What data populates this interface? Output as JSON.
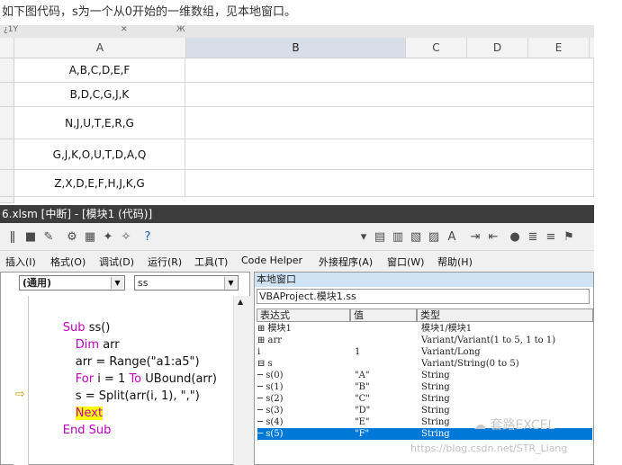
{
  "caption": "如下图代码，s为一个从0开始的一维数组，见本地窗口。",
  "excel": {
    "tab_fragments": [
      "¿1Ÿ",
      "✕",
      "Ж"
    ],
    "columns": [
      "A",
      "B",
      "C",
      "D",
      "E"
    ],
    "cells_A": [
      "A,B,C,D,E,F",
      "B,D,C,G,J,K",
      "N,J,U,T,E,R,G",
      "G,J,K,O,U,T,D,A,Q",
      "Z,X,D,E,F,H,J,K,G"
    ]
  },
  "vbe": {
    "title": "6.xlsm [中断] - [模块1 (代码)]",
    "menu": [
      "插入(I)",
      "格式(O)",
      "调试(D)",
      "运行(R)",
      "工具(T)",
      "Code Helper",
      "外接程序(A)",
      "窗口(W)",
      "帮助(H)"
    ],
    "code_pane": {
      "object_combo": "(通用)",
      "proc_combo": "ss",
      "lines": [
        {
          "parts": [
            {
              "t": "Sub ",
              "kw": true
            },
            {
              "t": "ss()",
              "kw": false
            }
          ]
        },
        {
          "parts": [
            {
              "t": "Dim ",
              "kw": true
            },
            {
              "t": "arr",
              "kw": false
            }
          ]
        },
        {
          "parts": [
            {
              "t": "arr = Range(\"a1:a5\")",
              "kw": false
            }
          ]
        },
        {
          "parts": [
            {
              "t": "For ",
              "kw": true
            },
            {
              "t": "i = 1 ",
              "kw": false
            },
            {
              "t": "To ",
              "kw": true
            },
            {
              "t": "UBound(arr)",
              "kw": false
            }
          ]
        },
        {
          "parts": [
            {
              "t": "s = Split(arr(i, 1), \",\")",
              "kw": false
            }
          ]
        },
        {
          "parts": [
            {
              "t": "Next",
              "kw": true
            }
          ]
        },
        {
          "parts": [
            {
              "t": "End Sub",
              "kw": true
            }
          ]
        }
      ]
    },
    "locals": {
      "title": "本地窗口",
      "context": "VBAProject.模块1.ss",
      "headers": [
        "表达式",
        "值",
        "类型"
      ],
      "rows": [
        {
          "expr": "⊞ 模块1",
          "value": "",
          "type": "模块1/模块1"
        },
        {
          "expr": "⊞ arr",
          "value": "",
          "type": "Variant/Variant(1 to 5, 1 to 1)"
        },
        {
          "expr": "   i",
          "value": "1",
          "type": "Variant/Long"
        },
        {
          "expr": "⊟ s",
          "value": "",
          "type": "Variant/String(0 to 5)"
        },
        {
          "expr": "  ─ s(0)",
          "value": "\"A\"",
          "type": "String"
        },
        {
          "expr": "  ─ s(1)",
          "value": "\"B\"",
          "type": "String"
        },
        {
          "expr": "  ─ s(2)",
          "value": "\"C\"",
          "type": "String"
        },
        {
          "expr": "  ─ s(3)",
          "value": "\"D\"",
          "type": "String"
        },
        {
          "expr": "  ─ s(4)",
          "value": "\"E\"",
          "type": "String"
        },
        {
          "expr": "  ─ s(5)",
          "value": "\"F\"",
          "type": "String"
        }
      ]
    }
  },
  "watermark": {
    "brand": "☁ 套路EXCEL",
    "url": "https://blog.csdn.net/STR_Liang"
  },
  "colors": {
    "keyword": "#c000c0",
    "highlight": "#ffff00",
    "selection": "#0078d7"
  }
}
